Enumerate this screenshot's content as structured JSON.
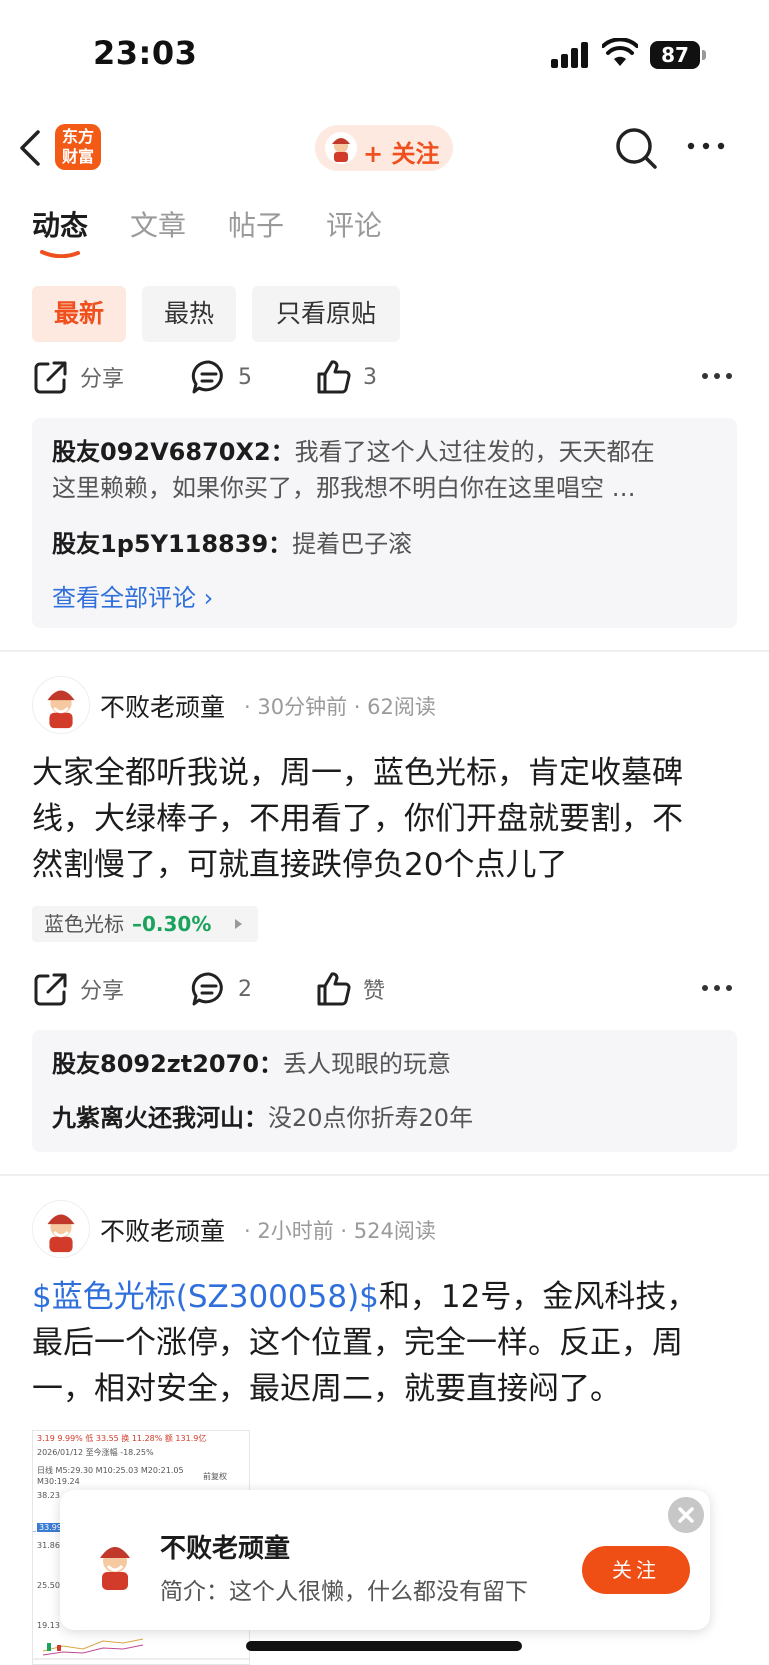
{
  "status": {
    "time": "23:03",
    "battery": "87"
  },
  "nav": {
    "logo_line1": "东方",
    "logo_line2": "财富",
    "follow_label": "+ 关注"
  },
  "tabs": [
    {
      "label": "动态"
    },
    {
      "label": "文章"
    },
    {
      "label": "帖子"
    },
    {
      "label": "评论"
    }
  ],
  "filters": [
    {
      "label": "最新"
    },
    {
      "label": "最热"
    },
    {
      "label": "只看原贴"
    }
  ],
  "post0": {
    "share": "分享",
    "comments": "5",
    "likes": "3",
    "replies": [
      {
        "user": "股友092V6870X2：",
        "text": "我看了这个人过往发的，天天都在",
        "text2": "这里赖赖，如果你买了，那我想不明白你在这里唱空 …"
      },
      {
        "user": "股友1p5Y118839：",
        "text": "提着巴子滚"
      }
    ],
    "view_all": "查看全部评论 ›"
  },
  "post1": {
    "author": "不败老顽童",
    "meta": "· 30分钟前 · 62阅读",
    "body_line1": "大家全都听我说，周一，蓝色光标，肯定收墓碑",
    "body_line2": "线，大绿棒子，不用看了，你们开盘就要割，不",
    "body_line3": "然割慢了，可就直接跌停负20个点儿了",
    "stock_name": "蓝色光标",
    "stock_change": "–0.30%",
    "share": "分享",
    "comments": "2",
    "likes": "赞",
    "replies": [
      {
        "user": "股友8092zt2070：",
        "text": "丢人现眼的玩意"
      },
      {
        "user": "九紫离火还我河山：",
        "text": "没20点你折寿20年"
      }
    ]
  },
  "post2": {
    "author": "不败老顽童",
    "meta": "· 2小时前 · 524阅读",
    "stock_link": "$蓝色光标(SZ300058)$",
    "body_line1_rest": "和，12号，金风科技，",
    "body_line2": "最后一个涨停，这个位置，完全一样。反正，周",
    "body_line3": "一，相对安全，最迟周二，就要直接闷了。",
    "thumb": {
      "row1": "3.19  9.99%  低  33.55  换  11.28%  额  131.9亿",
      "row2": "2026/01/12  至今涨幅 -18.25%",
      "row3": "日线  M5:29.30  M10:25.03  M20:21.05",
      "row4": "M30:19.24",
      "row5": "前复权",
      "y1": "38.23",
      "y2": "33.99",
      "y3": "31.86",
      "y4": "25.50",
      "y5": "19.13"
    }
  },
  "profile_card": {
    "name": "不败老顽童",
    "bio": "简介：这个人很懒，什么都没有留下",
    "follow": "关注"
  },
  "colors": {
    "accent": "#f0501e",
    "link": "#2f6fdb",
    "down": "#1aa35d"
  }
}
